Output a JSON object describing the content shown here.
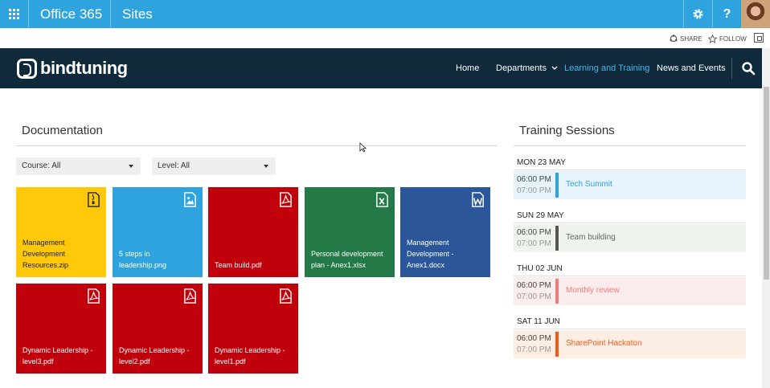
{
  "topbar": {
    "brand": "Office 365",
    "section": "Sites",
    "bg": "#2ea3de"
  },
  "subbar": {
    "share_label": "SHARE",
    "follow_label": "FOLLOW"
  },
  "site": {
    "logo_text": "bindtuning",
    "nav_bg": "#0e2a3b",
    "menu": {
      "home": "Home",
      "departments": "Departments",
      "learning": "Learning and Training",
      "news": "News and Events"
    },
    "active_color": "#48b5ea"
  },
  "documentation": {
    "title": "Documentation",
    "course_filter": "Course: All",
    "level_filter": "Level: All",
    "tiles": [
      {
        "name": "Management Development Resources.zip",
        "type": "zip",
        "color": "#ffc90a"
      },
      {
        "name": "5 steps in leadership.png",
        "type": "image",
        "color": "#2ea3de"
      },
      {
        "name": "Team build.pdf",
        "type": "pdf",
        "color": "#c0000a"
      },
      {
        "name": "Personal development plan - Anex1.xlsx",
        "type": "excel",
        "color": "#237a46"
      },
      {
        "name": "Management Development - Anex1.docx",
        "type": "word",
        "color": "#2b579a"
      },
      {
        "name": "Dynamic Leadership - level3.pdf",
        "type": "pdf",
        "color": "#c0000a"
      },
      {
        "name": "Dynamic Leadership - level2.pdf",
        "type": "pdf",
        "color": "#c0000a"
      },
      {
        "name": "Dynamic Leadership - level1.pdf",
        "type": "pdf",
        "color": "#c0000a"
      }
    ]
  },
  "training": {
    "title": "Training Sessions",
    "days": [
      {
        "date": "MON 23 MAY",
        "start": "06:00 PM",
        "end": "07:00 PM",
        "event": "Tech Summit",
        "accent": "#2ea3de",
        "bg": "#e6f3fa"
      },
      {
        "date": "SUN 29 MAY",
        "start": "06:00 PM",
        "end": "07:00 PM",
        "event": "Team building",
        "accent": "#555555",
        "bg": "#eef3ec"
      },
      {
        "date": "THU 02 JUN",
        "start": "06:00 PM",
        "end": "07:00 PM",
        "event": "Monthly review",
        "accent": "#f07a7a",
        "bg": "#fceded"
      },
      {
        "date": "SAT 11 JUN",
        "start": "06:00 PM",
        "end": "07:00 PM",
        "event": "SharePoint Hackaton",
        "accent": "#ef5b1d",
        "bg": "#fdeee4"
      }
    ]
  }
}
